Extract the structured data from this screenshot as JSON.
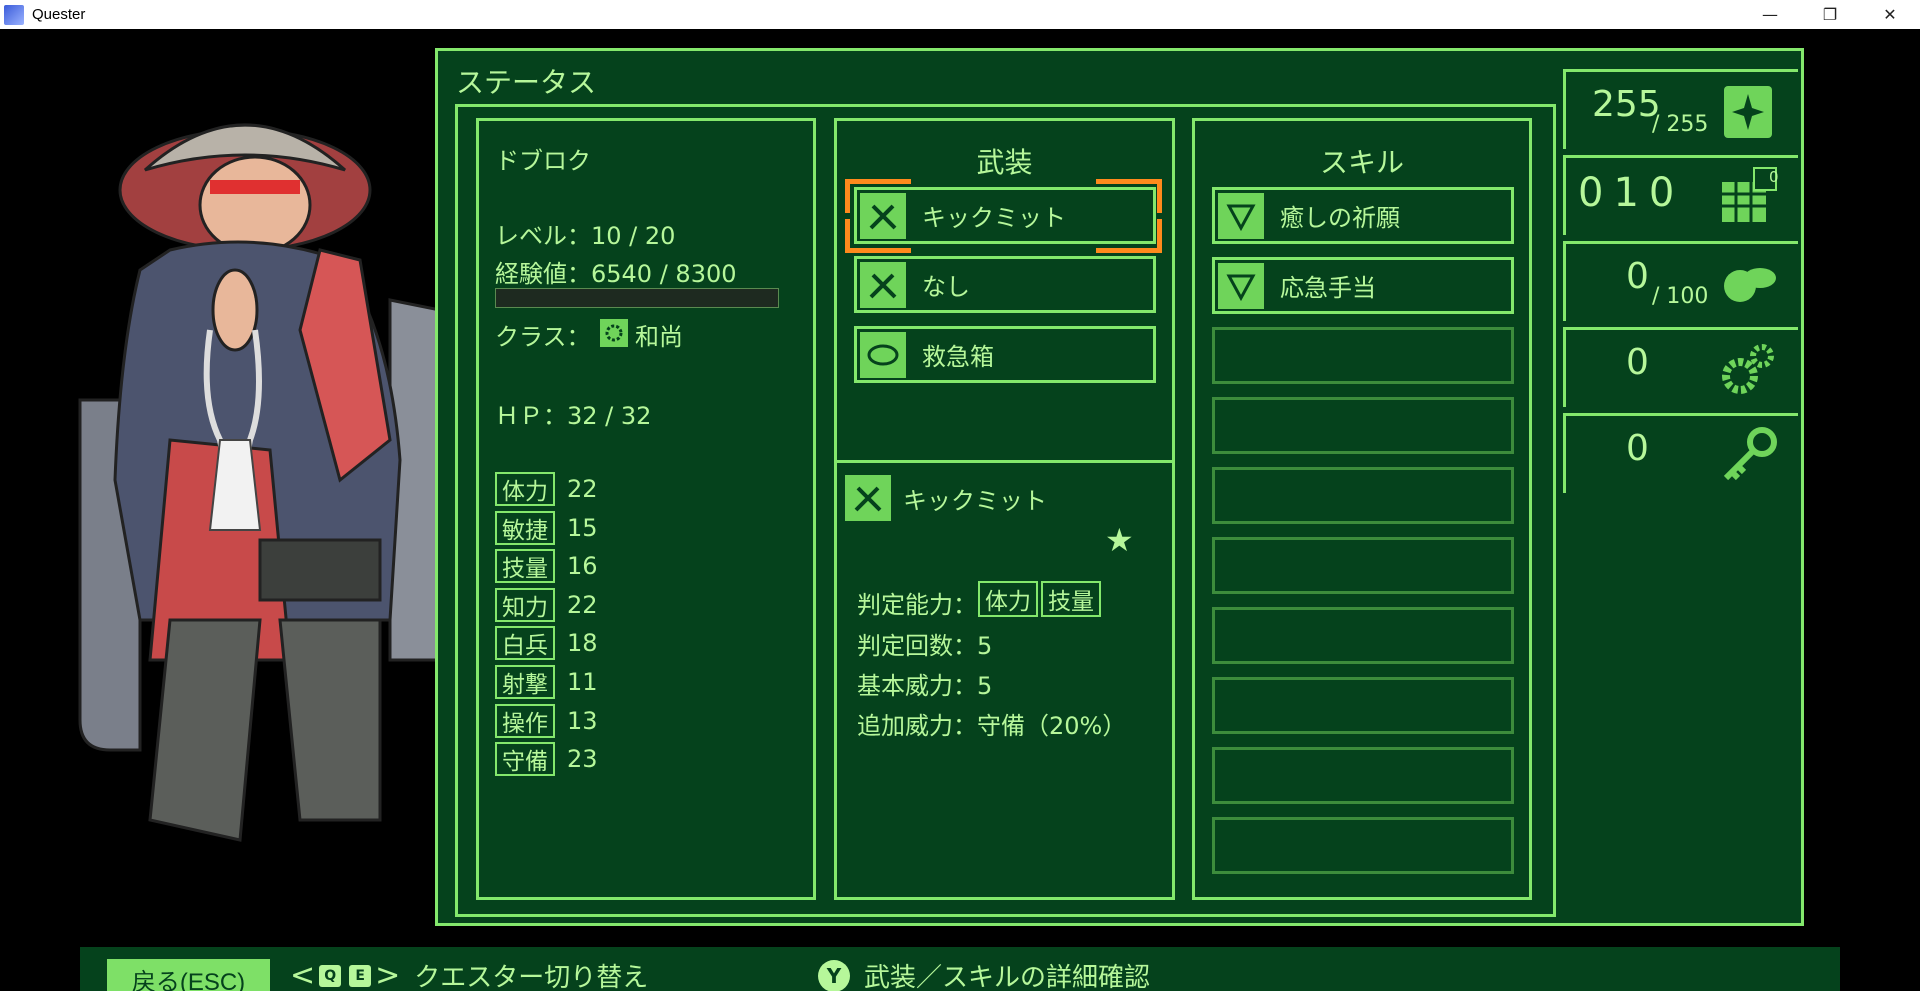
{
  "window": {
    "title": "Quester",
    "minimize_glyph": "—",
    "maximize_glyph": "❐",
    "close_glyph": "✕"
  },
  "panel": {
    "title": "ステータス"
  },
  "character": {
    "name": "ドブロク",
    "level_text": "レベル：10 / 20",
    "exp_text": "経験値：6540 / 8300",
    "exp_fraction": 0.0,
    "class_label": "クラス：",
    "class_value": "和尚",
    "hp_text": "ＨＰ：32 / 32",
    "stats": [
      {
        "key": "体力",
        "value": "22"
      },
      {
        "key": "敏捷",
        "value": "15"
      },
      {
        "key": "技量",
        "value": "16"
      },
      {
        "key": "知力",
        "value": "22"
      },
      {
        "key": "白兵",
        "value": "18"
      },
      {
        "key": "射撃",
        "value": "11"
      },
      {
        "key": "操作",
        "value": "13"
      },
      {
        "key": "守備",
        "value": "23"
      }
    ]
  },
  "equipment": {
    "heading": "武装",
    "slots": [
      {
        "label": "キックミット",
        "icon": "knife-icon",
        "selected": true
      },
      {
        "label": "なし",
        "icon": "knife-icon"
      },
      {
        "label": "救急箱",
        "icon": "medkit-icon"
      }
    ],
    "detail": {
      "name": "キックミット",
      "star": "★",
      "judge_label": "判定能力：",
      "judge_tags": [
        "体力",
        "技量"
      ],
      "count_text": "判定回数：5",
      "power_text": "基本威力：5",
      "extra_text": "追加威力：守備（20%）"
    }
  },
  "skills": {
    "heading": "スキル",
    "slots": [
      {
        "label": "癒しの祈願",
        "icon": "skill-icon"
      },
      {
        "label": "応急手当",
        "icon": "skill-icon"
      },
      {
        "label": ""
      },
      {
        "label": ""
      },
      {
        "label": ""
      },
      {
        "label": ""
      },
      {
        "label": ""
      },
      {
        "label": ""
      },
      {
        "label": ""
      },
      {
        "label": ""
      }
    ]
  },
  "counters": [
    {
      "value": "255",
      "max": "/ 255",
      "icon": "sparkle-card-icon"
    },
    {
      "value": "010",
      "badge": "0",
      "icon": "calendar-icon"
    },
    {
      "value": "0",
      "max": "/ 100",
      "icon": "food-icon"
    },
    {
      "value": "0",
      "icon": "gears-icon"
    },
    {
      "value": "0",
      "icon": "key-icon"
    }
  ],
  "bottom": {
    "back_label": "戻る(ESC)",
    "key_q": "Q",
    "key_e": "E",
    "switch_label": "クエスター切り替え",
    "key_y": "Y",
    "detail_label": "武装／スキルの詳細確認"
  },
  "colors": {
    "panel_bg": "#05421c",
    "line": "#84e86c",
    "text": "#b6f79a",
    "selection": "#ff8a1c"
  }
}
